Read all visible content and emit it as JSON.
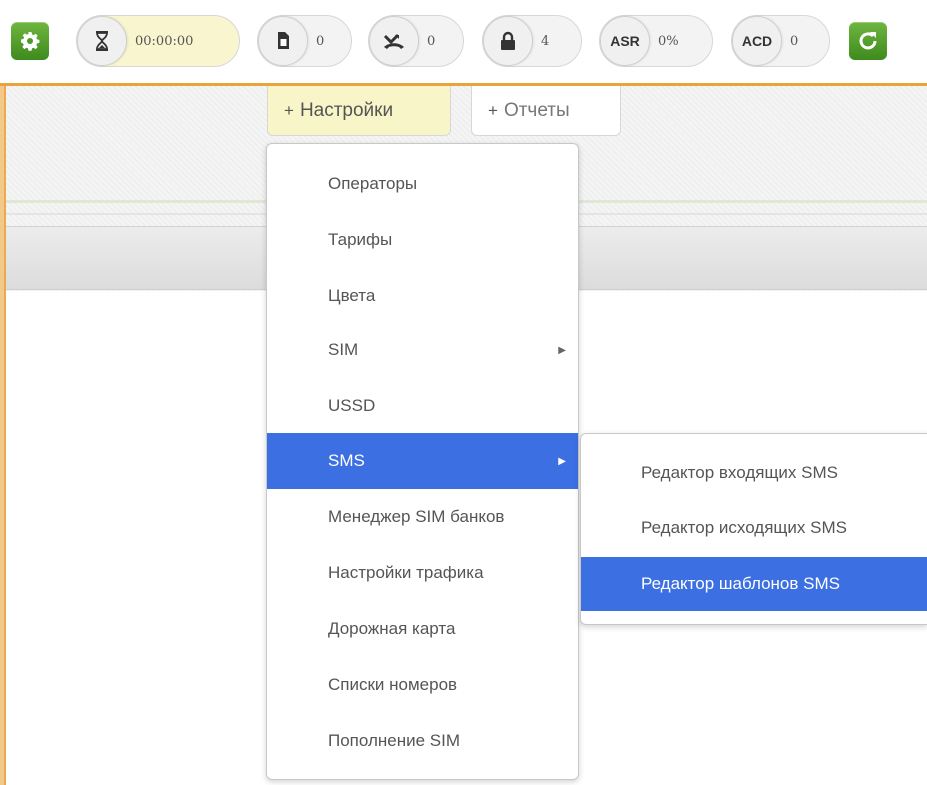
{
  "toolbar": {
    "timer_value": "00:00:00",
    "sim_count": "0",
    "calls_count": "0",
    "locked_count": "4",
    "asr_label": "ASR",
    "asr_value": "0%",
    "acd_label": "ACD",
    "acd_value": "0",
    "accent_color": "#e8a33c",
    "button_color": "#4c9a27"
  },
  "tabs": [
    {
      "plus": "+",
      "label": "Настройки"
    },
    {
      "plus": "+",
      "label": "Отчеты"
    }
  ],
  "menu": {
    "items": [
      {
        "label": "Операторы"
      },
      {
        "label": "Тарифы"
      },
      {
        "label": "Цвета"
      },
      {
        "label": "SIM",
        "submenu_arrow": "▶"
      },
      {
        "label": "USSD"
      },
      {
        "label": "SMS",
        "submenu_arrow": "▶"
      },
      {
        "label": "Менеджер SIM банков"
      },
      {
        "label": "Настройки трафика"
      },
      {
        "label": "Дорожная карта"
      },
      {
        "label": "Списки номеров"
      },
      {
        "label": "Пополнение SIM"
      }
    ],
    "selected_color": "#3b6fe2"
  },
  "submenu": {
    "items": [
      {
        "label": "Редактор входящих SMS"
      },
      {
        "label": "Редактор исходящих SMS"
      },
      {
        "label": "Редактор шаблонов SMS"
      }
    ]
  }
}
